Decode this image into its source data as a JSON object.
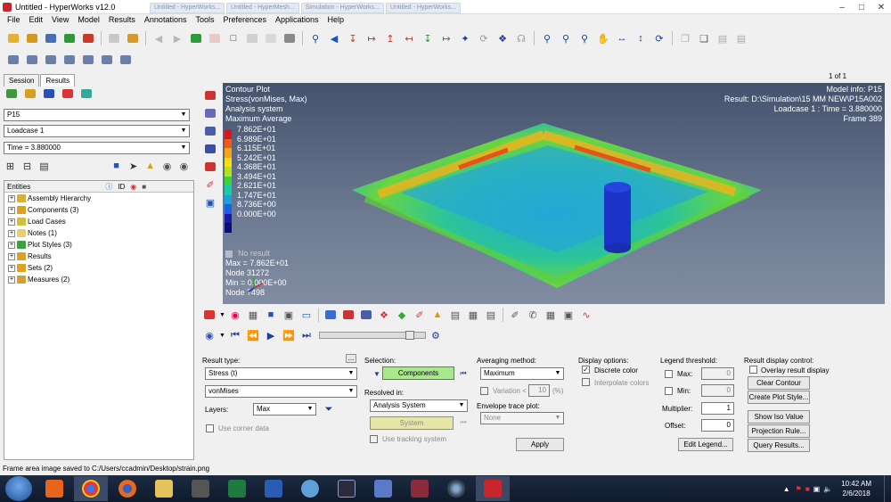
{
  "window": {
    "title": "Untitled - HyperWorks v12.0",
    "tabs_ghost": [
      "Untitled - HyperWorks...",
      "Untitled - HyperMesh...",
      "Simulation - HyperWorks...",
      "Untitled - HyperWorks..."
    ]
  },
  "menu": [
    "File",
    "Edit",
    "View",
    "Model",
    "Results",
    "Annotations",
    "Tools",
    "Preferences",
    "Applications",
    "Help"
  ],
  "panel": {
    "tabs": [
      "Session",
      "Results"
    ],
    "model_select": "P15",
    "loadcase": "Loadcase 1",
    "time": "Time = 3.880000",
    "entities_header": {
      "name": "Entities",
      "id": "ID"
    },
    "entities": [
      {
        "label": "Assembly Hierarchy",
        "color": "#d4b03a"
      },
      {
        "label": "Components (3)",
        "color": "#e0a020"
      },
      {
        "label": "Load Cases",
        "color": "#d0c040"
      },
      {
        "label": "Notes (1)",
        "color": "#e8d070"
      },
      {
        "label": "Plot Styles (3)",
        "color": "#3fa040"
      },
      {
        "label": "Results",
        "color": "#d9a02a"
      },
      {
        "label": "Sets (2)",
        "color": "#e0a020"
      },
      {
        "label": "Measures (2)",
        "color": "#d0a030"
      }
    ]
  },
  "view": {
    "page": "1 of 1",
    "header_left": [
      "Contour Plot",
      "Stress(vonMises, Max)",
      "Analysis system",
      "Maximum Average"
    ],
    "header_right": [
      "Model info: P15",
      "Result: D:\\Simulation\\15 MM NEW\\P15A002",
      "Loadcase 1 : Time = 3.880000",
      "Frame 389"
    ],
    "legend": {
      "values": [
        "7.862E+01",
        "6.989E+01",
        "6.115E+01",
        "5.242E+01",
        "4.368E+01",
        "3.494E+01",
        "2.621E+01",
        "1.747E+01",
        "8.736E+00",
        "0.000E+00"
      ],
      "colors": [
        "#d7191c",
        "#ee5a1a",
        "#f9a11a",
        "#f8df14",
        "#b5e31d",
        "#39d33a",
        "#16cba6",
        "#1aa2e0",
        "#1c5fe6",
        "#1a1aa8",
        "#0c0c77"
      ],
      "no_result": "No result",
      "max": "Max = 7.862E+01",
      "max_node": "Node 31272",
      "min": "Min = 0.000E+00",
      "min_node": "Node 7498"
    }
  },
  "results_panel": {
    "result_type_label": "Result type:",
    "result_type": "Stress (t)",
    "component": "vonMises",
    "layers_label": "Layers:",
    "layers": "Max",
    "use_corner_data": "Use corner data",
    "selection_label": "Selection:",
    "selection": "Components",
    "resolved_in_label": "Resolved in:",
    "resolved_in": "Analysis System",
    "system": "System",
    "use_tracking": "Use tracking system",
    "averaging_label": "Averaging method:",
    "averaging": "Maximum",
    "variation_label": "Variation <",
    "variation_value": "10",
    "variation_unit": "(%)",
    "envelope_label": "Envelope trace plot:",
    "envelope": "None",
    "apply": "Apply",
    "display_options_label": "Display options:",
    "discrete_colors": "Discrete color",
    "interpolate_colors": "Interpolate colors",
    "legend_threshold_label": "Legend threshold:",
    "max_label": "Max:",
    "max_value": "0",
    "min_label": "Min:",
    "min_value": "0",
    "multiplier_label": "Multiplier:",
    "multiplier": "1",
    "offset_label": "Offset:",
    "offset": "0",
    "edit_legend": "Edit Legend...",
    "result_display_label": "Result display control:",
    "overlay": "Overlay result display",
    "clear_contour": "Clear Contour",
    "create_plot_style": "Create Plot Style...",
    "show_iso": "Show Iso Value",
    "projection_rule": "Projection Rule...",
    "query_results": "Query Results..."
  },
  "status": "Frame area image saved to C:/Users/ccadmin/Desktop/strain.png",
  "taskbar": {
    "time": "10:42 AM",
    "date": "2/6/2018"
  }
}
